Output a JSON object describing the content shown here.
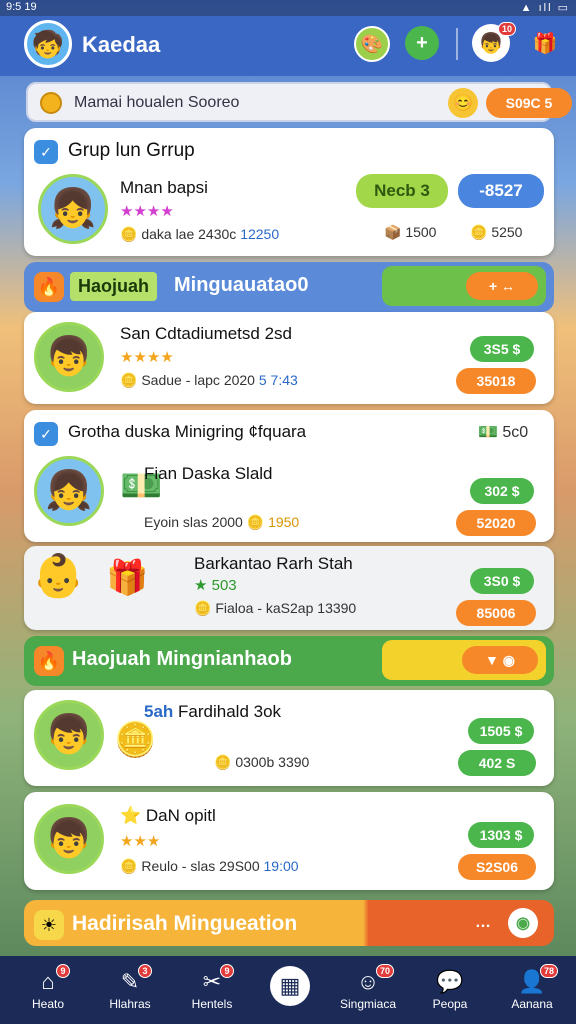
{
  "status": {
    "time": "9:5 19",
    "signal": "▲ ıll ▭"
  },
  "header": {
    "app_name": "Kaedaa",
    "profile_badge": "10"
  },
  "search": {
    "placeholder": "Mamai houalen Sooreo",
    "pill_value": "S09C 5"
  },
  "group_card": {
    "title": "Grup lun Grrup",
    "item": {
      "name": "Mnan bapsi",
      "stars": "★★★★",
      "meta_label": "daka lae 2430c",
      "meta_value": "12250",
      "left_pill": "Necb 3",
      "right_pill": "-8527",
      "count_a": "1500",
      "count_b": "5250"
    }
  },
  "section1": {
    "tag": "Haojuah",
    "title": "Minguauatao0",
    "btn_label": "+ ↔"
  },
  "card2": {
    "name": "San Cdtadiumetsd 2sd",
    "stars": "★★★★",
    "meta": "Sadue - lapc 2020",
    "meta_extra": "5 7:43",
    "pill_top": "3S5 $",
    "pill_bottom": "35018"
  },
  "card3": {
    "title": "Grotha duska Minigring ¢fquara",
    "side_value": "5c0",
    "name": "Fian Daska Slald",
    "meta": "Eyoin slas 2000",
    "meta_value": "1950",
    "pill_top": "302 $",
    "pill_bottom": "52020"
  },
  "card4": {
    "name": "Barkantao Rarh Stah",
    "stars": "★ 503",
    "meta": "Fialoa - kaS2ap",
    "meta_value": "13390",
    "pill_top": "3S0 $",
    "pill_bottom": "85006"
  },
  "section2": {
    "title": "Haojuah Mingnianhaob"
  },
  "card5": {
    "name": "5ah",
    "name_rest": "Fardihald 3ok",
    "meta": "0300b",
    "meta_value": "3390",
    "pill_top": "1505 $",
    "pill_bottom": "402 S"
  },
  "card6": {
    "name": "DaN opitl",
    "stars": "★★★",
    "meta": "Reulo - slas 29S00",
    "meta_value": "19:00",
    "pill_top": "1303 $",
    "pill_bottom": "S2S06"
  },
  "section3": {
    "title": "Hadirisah Mingueation"
  },
  "nav": [
    {
      "label": "Heato",
      "icon": "home-icon",
      "badge": "9"
    },
    {
      "label": "Hlahras",
      "icon": "chat-icon",
      "badge": "3"
    },
    {
      "label": "Hentels",
      "icon": "tools-icon",
      "badge": "9"
    },
    {
      "label": "",
      "icon": "grid-icon",
      "badge": ""
    },
    {
      "label": "Singmiaca",
      "icon": "people-icon",
      "badge": "70"
    },
    {
      "label": "Peopa",
      "icon": "bubble-icon",
      "badge": ""
    },
    {
      "label": "Aanana",
      "icon": "user-icon",
      "badge": "78"
    }
  ],
  "colors": {
    "primary": "#3b67c4",
    "green": "#4bb64b",
    "orange": "#f6882a",
    "nav": "#1b2a57"
  }
}
